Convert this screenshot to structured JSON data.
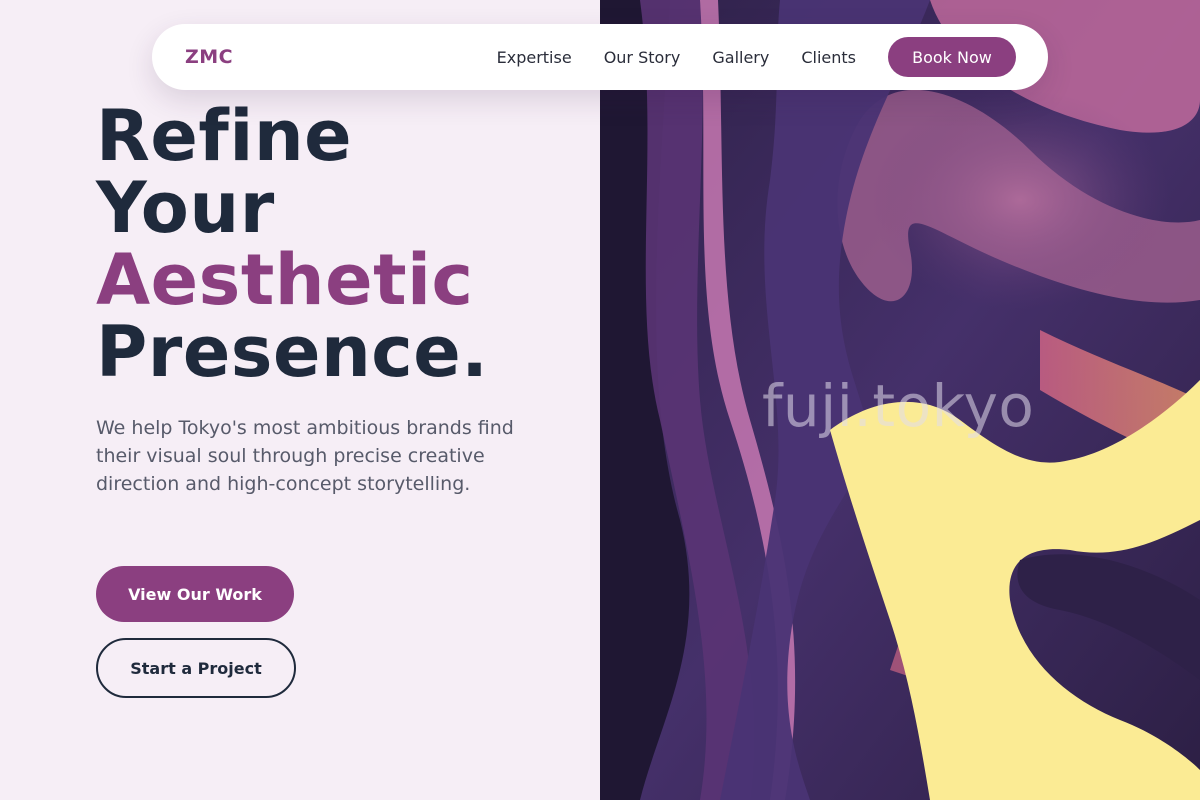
{
  "brand": {
    "logo": "ZMC"
  },
  "nav": {
    "links": [
      "Expertise",
      "Our Story",
      "Gallery",
      "Clients"
    ],
    "cta": "Book Now"
  },
  "hero": {
    "line1": "Refine",
    "line2": "Your",
    "line3": "Aesthetic",
    "line4": "Presence.",
    "description": "We help Tokyo's most ambitious brands find their visual soul through precise creative direction and high-concept storytelling.",
    "primary_cta": "View Our Work",
    "secondary_cta": "Start a Project"
  },
  "art": {
    "watermark": "fuji.tokyo"
  },
  "colors": {
    "accent": "#8b3f80",
    "heading": "#1f2a3c",
    "background": "#f6eef6",
    "art_purple": "#3a2a5e",
    "art_yellow": "#fbeb94"
  }
}
